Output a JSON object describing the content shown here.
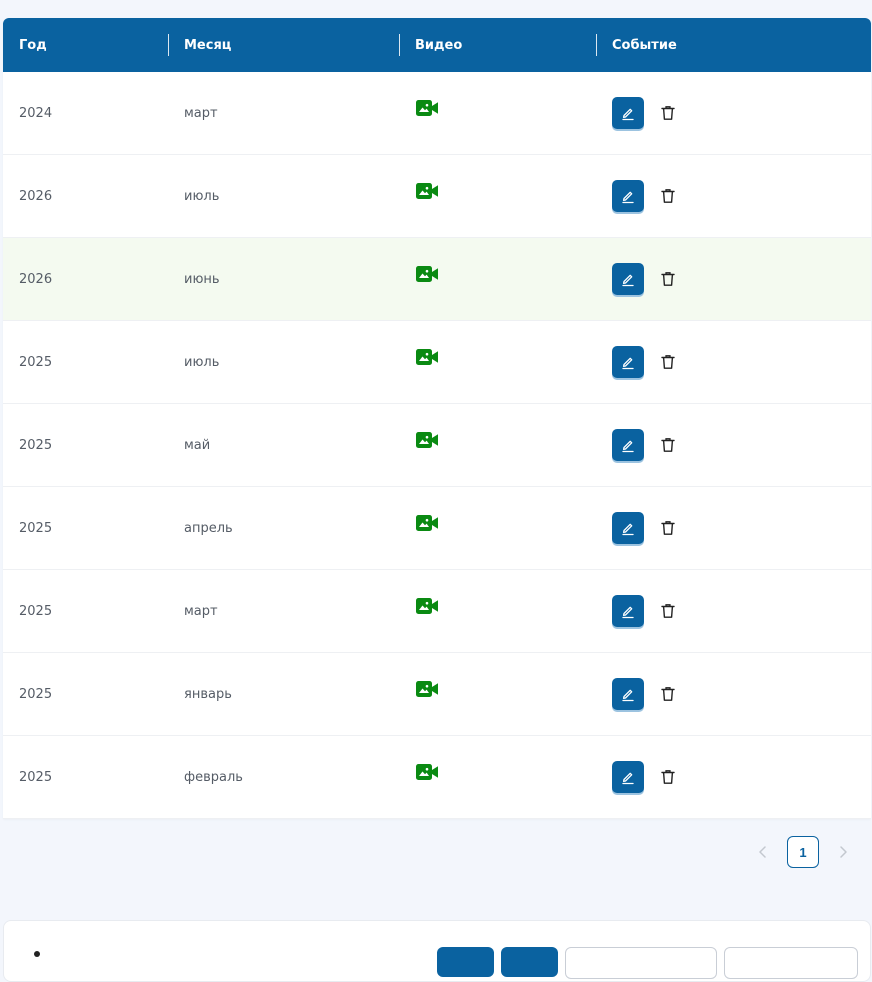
{
  "table": {
    "headers": {
      "year": "Год",
      "month": "Месяц",
      "video": "Видео",
      "event": "Событие"
    },
    "rows": [
      {
        "year": "2024",
        "month": "март"
      },
      {
        "year": "2026",
        "month": "июль"
      },
      {
        "year": "2026",
        "month": "июнь"
      },
      {
        "year": "2025",
        "month": "июль"
      },
      {
        "year": "2025",
        "month": "май"
      },
      {
        "year": "2025",
        "month": "апрель"
      },
      {
        "year": "2025",
        "month": "март"
      },
      {
        "year": "2025",
        "month": "январь"
      },
      {
        "year": "2025",
        "month": "февраль"
      }
    ],
    "highlighted_row_index": 2,
    "icons": {
      "video": "video-camera-icon",
      "edit": "pencil-icon",
      "delete": "trash-icon"
    }
  },
  "pagination": {
    "current_page": "1",
    "prev_icon": "chevron-left-icon",
    "next_icon": "chevron-right-icon"
  },
  "colors": {
    "header_bg": "#0a62a0",
    "video_icon": "#0a8a12",
    "highlight_row": "#f4faf0",
    "page_bg": "#f3f6fc"
  }
}
